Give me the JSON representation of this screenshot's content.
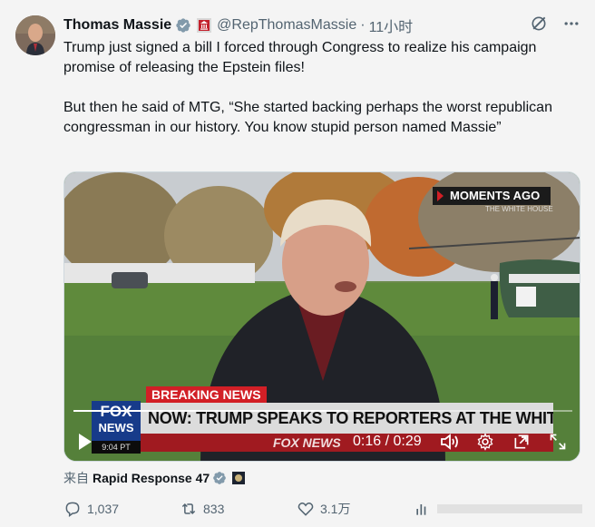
{
  "author": {
    "name": "Thomas Massie",
    "handle": "@RepThomasMassie",
    "separator": "·",
    "time": "11小时"
  },
  "tweet": {
    "paragraph1": "Trump just signed a bill I forced through Congress to realize his campaign promise of releasing the Epstein files!",
    "paragraph2": "But then he said of MTG, “She started backing perhaps the worst republican congressman in our history. You know stupid person named Massie”"
  },
  "video": {
    "moments_ago": "MOMENTS AGO",
    "white_house": "THE WHITE HOUSE",
    "breaking": "BREAKING NEWS",
    "headline": "NOW: TRUMP SPEAKS TO REPORTERS AT THE WHITE HOUSE",
    "network_fox": "FOX",
    "network_news": "NEWS",
    "ticker_brand": "FOX NEWS",
    "clock": "9:04 PT",
    "timestamp": "0:16 / 0:29",
    "progress": 0.55
  },
  "source": {
    "label": "来自",
    "account": "Rapid Response 47"
  },
  "actions": {
    "replies": "1,037",
    "reposts": "833",
    "likes": "3.1万"
  },
  "colors": {
    "verified": "#1d9bf0",
    "breaking": "#d21f26",
    "banner": "#dcdcdc",
    "fox_blue": "#173b8a"
  }
}
